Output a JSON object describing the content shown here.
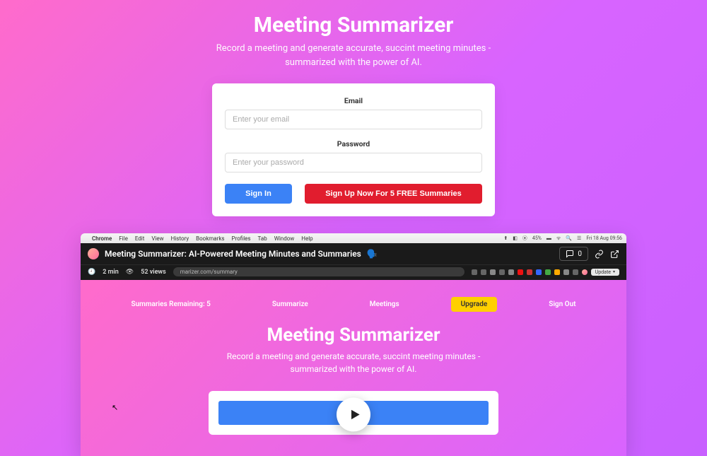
{
  "hero": {
    "title": "Meeting Summarizer",
    "subtitle_line1": "Record a meeting and generate accurate, succint meeting minutes -",
    "subtitle_line2": "summarized with the power of AI."
  },
  "form": {
    "email_label": "Email",
    "email_placeholder": "Enter your email",
    "password_label": "Password",
    "password_placeholder": "Enter your password",
    "signin_label": "Sign In",
    "signup_label": "Sign Up Now For 5 FREE Summaries"
  },
  "video": {
    "menubar": {
      "apple": "",
      "items": [
        "Chrome",
        "File",
        "Edit",
        "View",
        "History",
        "Bookmarks",
        "Profiles",
        "Tab",
        "Window",
        "Help"
      ],
      "battery": "45%",
      "datetime": "Fri 18 Aug  09:56"
    },
    "header": {
      "title": "Meeting Summarizer: AI-Powered Meeting Minutes and Summaries",
      "speaker_emoji": "🗣️",
      "comments": "0"
    },
    "meta": {
      "duration": "2 min",
      "views": "52 views",
      "address": "marizer.com/summary",
      "update": "Update"
    },
    "nav": {
      "remaining": "Summaries Remaining: 5",
      "summarize": "Summarize",
      "meetings": "Meetings",
      "upgrade": "Upgrade",
      "signout": "Sign Out"
    },
    "hero": {
      "title": "Meeting Summarizer",
      "sub1": "Record a meeting and generate accurate, succint meeting minutes -",
      "sub2": "summarized with the power of AI."
    }
  }
}
